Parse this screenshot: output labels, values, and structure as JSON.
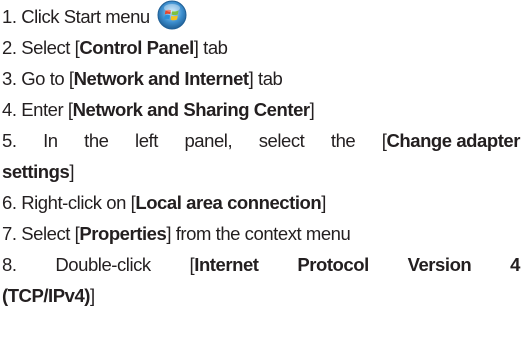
{
  "steps": [
    {
      "num": "1.",
      "pre": "Click Start menu",
      "icon": "windows-start-orb-icon"
    },
    {
      "num": "2.",
      "pre": "Select [",
      "bold": "Control Panel",
      "post": "] tab"
    },
    {
      "num": "3.",
      "pre": "Go to [",
      "bold": "Network and Internet",
      "post": "] tab"
    },
    {
      "num": "4.",
      "pre": "Enter [",
      "bold": "Network and Sharing Center",
      "post": "]"
    },
    {
      "num": "5.",
      "words": [
        "In",
        "the",
        "left",
        "panel,",
        "select",
        "the",
        "["
      ],
      "bold_a": "Change adapter",
      "bold_b": "settings",
      "post": "]"
    },
    {
      "num": "6.",
      "pre": "Right-click on [",
      "bold": "Local area connection",
      "post": "]"
    },
    {
      "num": "7.",
      "pre": "Select [",
      "bold": "Properties",
      "post": "] from the context menu"
    },
    {
      "num": "8.",
      "words": [
        "Double-click",
        "["
      ],
      "bold_words": [
        "Internet",
        "Protocol",
        "Version",
        "4"
      ],
      "bold_b": "(TCP/IPv4)",
      "post": "]"
    }
  ],
  "colors": {
    "text": "#231f20",
    "orb_red": "#e8452c",
    "orb_green": "#7cc242",
    "orb_blue": "#2a8fd9",
    "orb_yellow": "#f6c21c",
    "orb_rim": "#1f5f96"
  }
}
